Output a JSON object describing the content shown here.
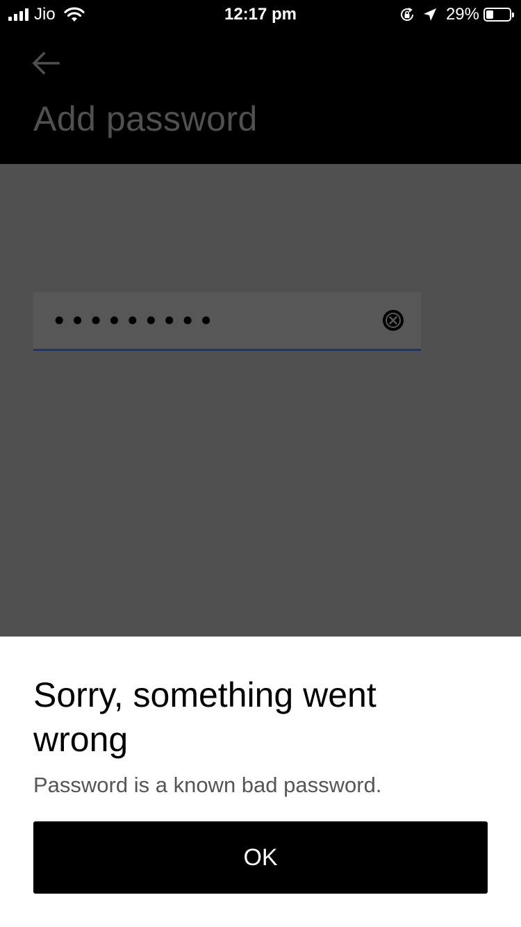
{
  "status_bar": {
    "carrier": "Jio",
    "time": "12:17 pm",
    "battery_percent": "29%",
    "icons": [
      "signal-icon",
      "wifi-icon",
      "rotation-lock-icon",
      "location-arrow-icon",
      "battery-icon"
    ]
  },
  "header": {
    "back_icon": "arrow-left-icon",
    "title": "Add password"
  },
  "password_field": {
    "value": "•••••••••",
    "clear_icon": "clear-circle-x-icon"
  },
  "dialog": {
    "title": "Sorry, something went wrong",
    "message": "Password is a known bad password.",
    "ok_label": "OK"
  }
}
